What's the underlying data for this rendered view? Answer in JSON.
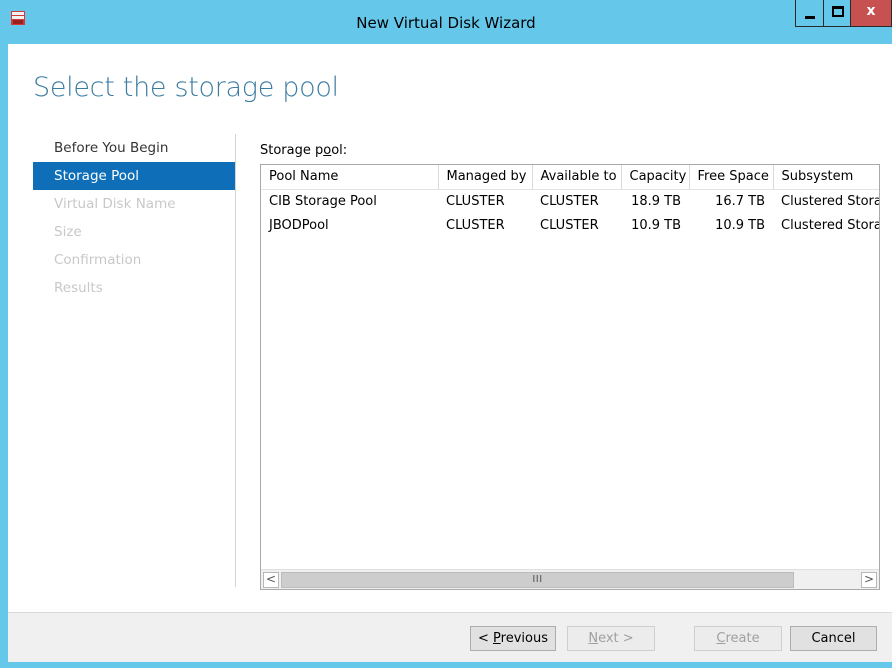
{
  "window": {
    "title": "New Virtual Disk Wizard",
    "close_glyph": "x"
  },
  "page": {
    "title": "Select the storage pool"
  },
  "nav": {
    "items": [
      {
        "label": "Before You Begin",
        "state": "normal"
      },
      {
        "label": "Storage Pool",
        "state": "active"
      },
      {
        "label": "Virtual Disk Name",
        "state": "disabled"
      },
      {
        "label": "Size",
        "state": "disabled"
      },
      {
        "label": "Confirmation",
        "state": "disabled"
      },
      {
        "label": "Results",
        "state": "disabled"
      }
    ]
  },
  "pool": {
    "label_pre": "Storage p",
    "label_key": "o",
    "label_post": "ol:",
    "columns": [
      "Pool Name",
      "Managed by",
      "Available to",
      "Capacity",
      "Free Space",
      "Subsystem"
    ],
    "rows": [
      [
        "CIB Storage Pool",
        "CLUSTER",
        "CLUSTER",
        "18.9 TB",
        "16.7 TB",
        "Clustered Stora"
      ],
      [
        "JBODPool",
        "CLUSTER",
        "CLUSTER",
        "10.9 TB",
        "10.9 TB",
        "Clustered Stora"
      ]
    ],
    "scroll_left": "<",
    "scroll_right": ">",
    "scroll_grip": "III"
  },
  "buttons": {
    "previous": {
      "pre": "< ",
      "key": "P",
      "post": "revious"
    },
    "next": {
      "pre": "",
      "key": "N",
      "post": "ext >"
    },
    "create": {
      "pre": "",
      "key": "C",
      "post": "reate"
    },
    "cancel": "Cancel"
  },
  "colors": {
    "titlebar": "#65c8ea",
    "nav_active": "#0e6fb8",
    "title_text": "#3a7ba0",
    "close_button": "#c75050"
  },
  "icons": {
    "app": "server-manager-icon",
    "minimize": "minimize-icon",
    "maximize": "maximize-icon",
    "close": "close-icon"
  }
}
